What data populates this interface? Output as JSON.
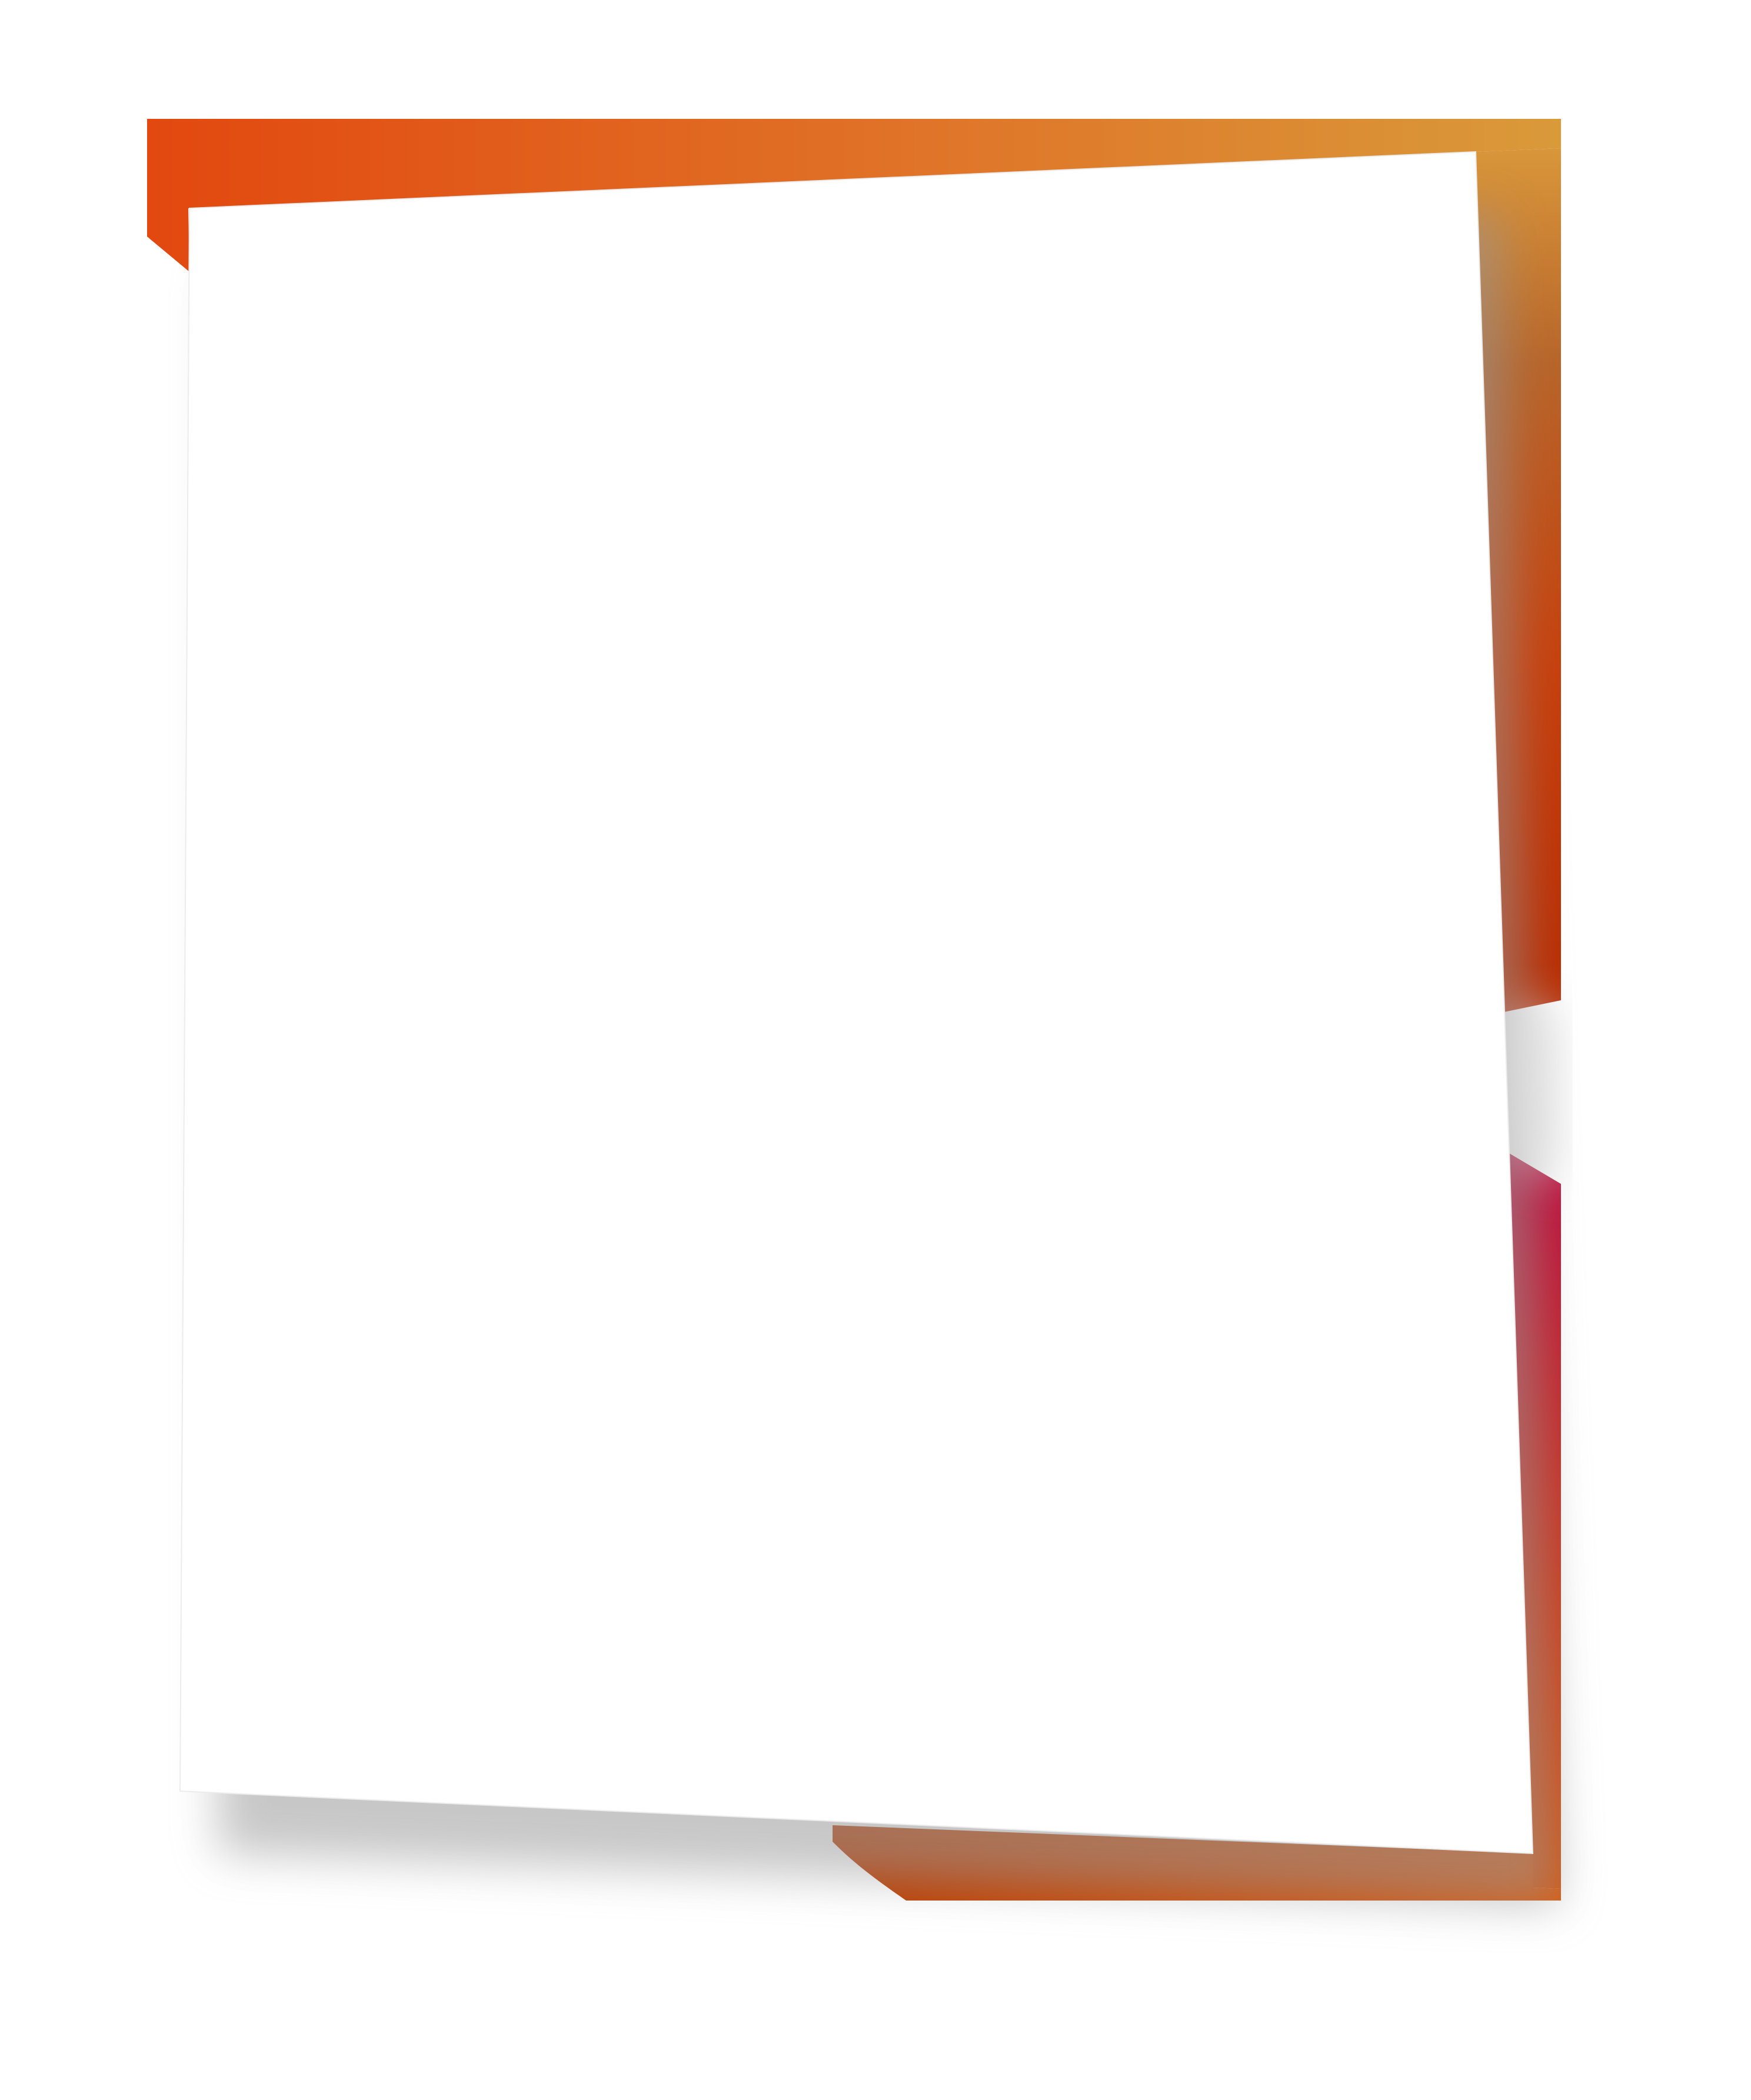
{
  "canvas": {
    "background": "#ffffff"
  },
  "frame": {
    "top_gradient": [
      "#e2480f",
      "#e07428",
      "#d99a3a"
    ],
    "right_gradient": [
      "#d9963a",
      "#b7652a",
      "#c6400d",
      "#b72a00"
    ],
    "lower_gradient": [
      "#bb0e3f",
      "#cb3a1a",
      "#d4550f"
    ],
    "bottom_gradient": [
      "#ba3f05",
      "#d85a10"
    ]
  },
  "sheet": {
    "fill": "#ffffff",
    "shadow": "#9a9a9a"
  }
}
